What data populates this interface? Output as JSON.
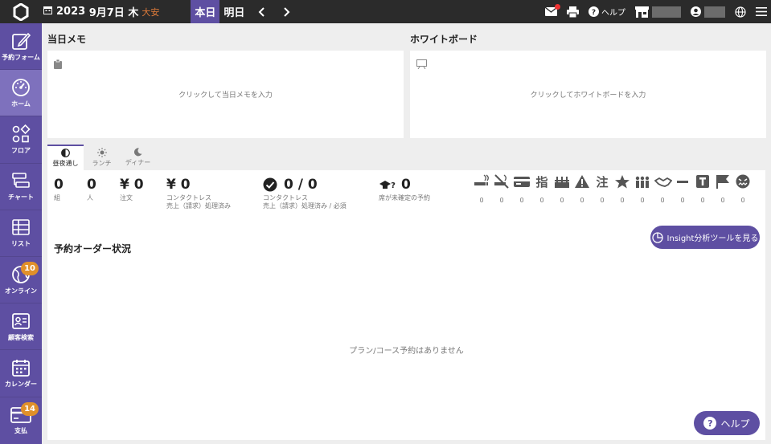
{
  "topbar": {
    "year": "2023",
    "month_day": "9月7日",
    "weekday": "木",
    "rokuyo": "大安",
    "today_label": "本日",
    "tomorrow_label": "明日",
    "help_label": "ヘルプ",
    "mail_badge_color": "#e33333"
  },
  "sidebar": {
    "items": [
      {
        "label": "予約フォーム",
        "icon": "edit-icon"
      },
      {
        "label": "ホーム",
        "icon": "dashboard-icon",
        "active": true
      },
      {
        "label": "フロア",
        "icon": "shapes-icon"
      },
      {
        "label": "チャート",
        "icon": "chart-icon"
      },
      {
        "label": "リスト",
        "icon": "table-icon"
      },
      {
        "label": "オンライン",
        "icon": "globe-icon",
        "badge": "10"
      },
      {
        "label": "顧客検索",
        "icon": "id-card-icon"
      },
      {
        "label": "カレンダー",
        "icon": "calendar-icon"
      },
      {
        "label": "支払",
        "icon": "credit-card-icon",
        "badge": "14"
      }
    ]
  },
  "memo": {
    "title": "当日メモ",
    "hint": "クリックして当日メモを入力"
  },
  "whiteboard": {
    "title": "ホワイトボード",
    "hint": "クリックしてホワイトボードを入力"
  },
  "meal_tabs": [
    {
      "label": "昼夜通し",
      "active": true
    },
    {
      "label": "ランチ"
    },
    {
      "label": "ディナー"
    }
  ],
  "stats": {
    "groups": {
      "value": "0",
      "label": "組"
    },
    "people": {
      "value": "0",
      "label": "人"
    },
    "orders": {
      "value": "¥ 0",
      "label": "注文"
    },
    "contactless": {
      "value": "¥ 0",
      "label1": "コンタクトレス",
      "label2": "売上（請求）処理済み"
    },
    "contactless_ratio": {
      "value": "0 / 0",
      "label1": "コンタクトレス",
      "label2": "売上（請求）処理済み / 必須"
    },
    "unassigned": {
      "value": "0",
      "label": "席が未確定の予約"
    }
  },
  "flags": [
    {
      "icon": "smoking-icon",
      "count": "0"
    },
    {
      "icon": "no-smoking-icon",
      "count": "0"
    },
    {
      "icon": "card-icon",
      "count": "0"
    },
    {
      "icon": "finger-icon",
      "count": "0"
    },
    {
      "icon": "cake-icon",
      "count": "0"
    },
    {
      "icon": "warning-icon",
      "count": "0"
    },
    {
      "icon": "note-icon",
      "count": "0"
    },
    {
      "icon": "star-icon",
      "count": "0"
    },
    {
      "icon": "group-icon",
      "count": "0"
    },
    {
      "icon": "handshake-icon",
      "count": "0"
    },
    {
      "icon": "minus-icon",
      "count": "0"
    },
    {
      "icon": "t-icon",
      "count": "0"
    },
    {
      "icon": "flag-icon",
      "count": "0"
    },
    {
      "icon": "angry-face-icon",
      "count": "0"
    }
  ],
  "insight_button": "Insight分析ツールを見る",
  "order_section": {
    "title": "予約オーダー状況",
    "empty": "プラン/コース予約はありません"
  },
  "help_fab": "ヘルプ",
  "colors": {
    "brand": "#5e4fa2",
    "topbar": "#2b2b2b",
    "badge": "#e0902a",
    "rokuyo": "#e07c3a"
  }
}
